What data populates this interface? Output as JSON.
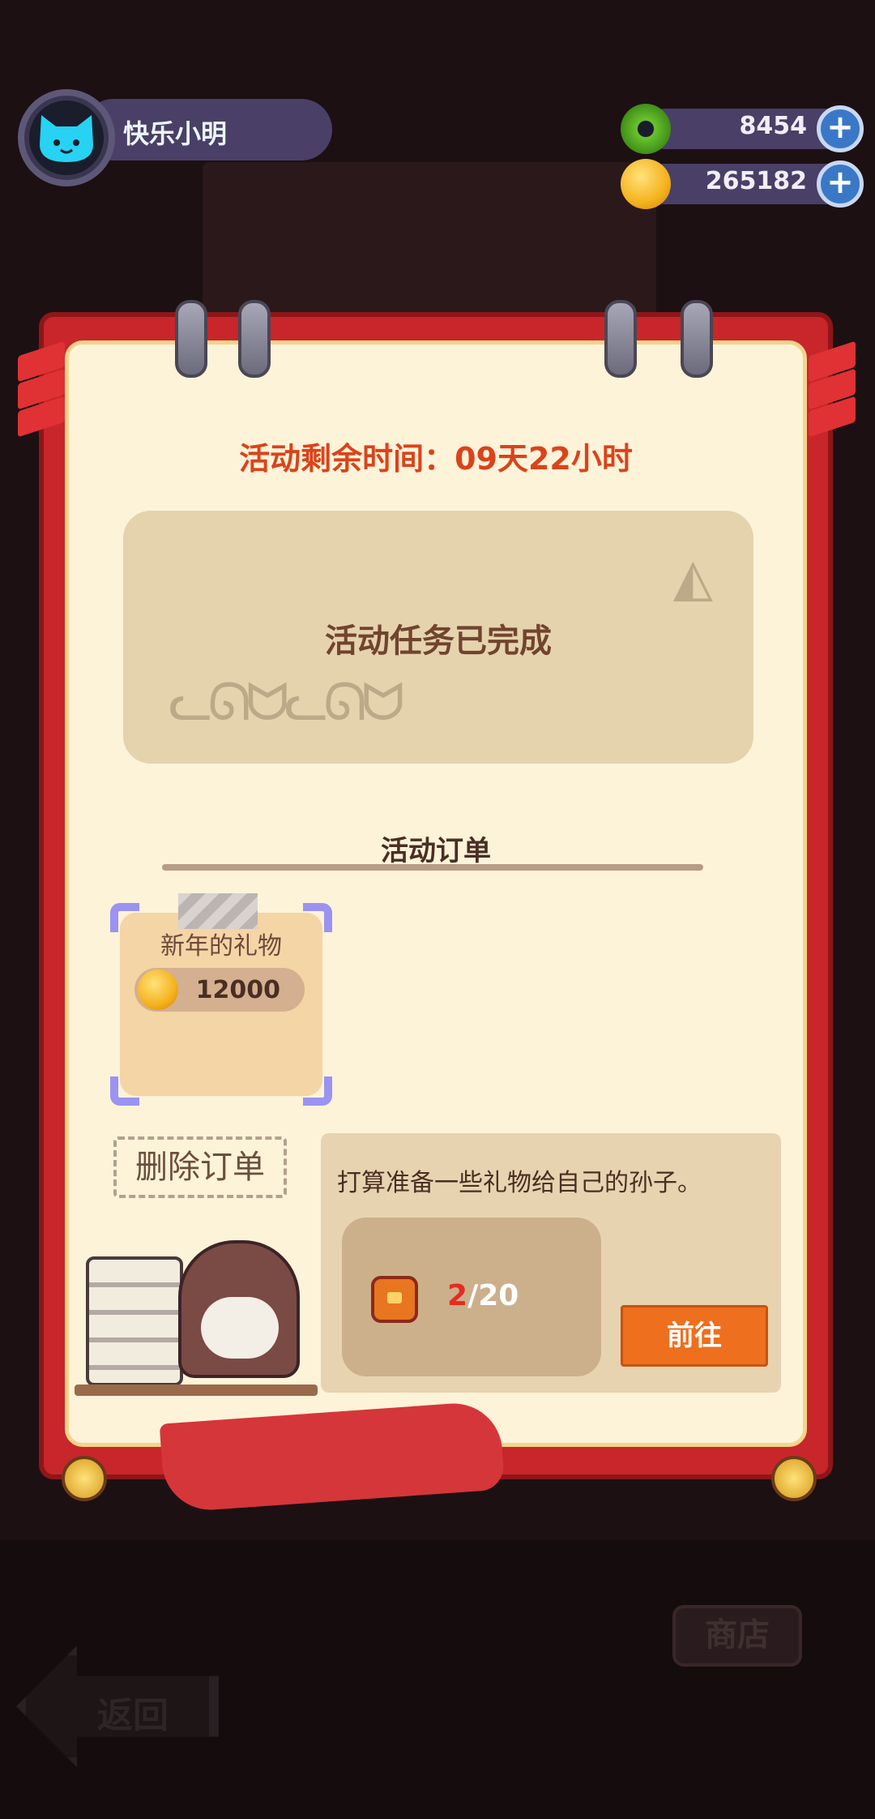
{
  "profile": {
    "name": "快乐小明"
  },
  "currencies": [
    {
      "icon": "green-donut-icon",
      "value": "8454",
      "color": "#5db524"
    },
    {
      "icon": "gold-coin-icon",
      "value": "265182",
      "color": "#f4b21d"
    }
  ],
  "event": {
    "timer_text": "活动剩余时间：09天22小时",
    "tasks_done_text": "活动任务已完成"
  },
  "orders": {
    "section_title": "活动订单",
    "items": [
      {
        "name": "新年的礼物",
        "reward": "12000"
      }
    ],
    "delete_label": "删除订单"
  },
  "order_detail": {
    "description": "打算准备一些礼物给自己的孙子。",
    "progress_current": "2",
    "progress_total": "/20",
    "goto_label": "前往"
  },
  "nav": {
    "back_label": "返回",
    "shop_label": "商店"
  },
  "colors": {
    "accent_orange": "#ee6f1e",
    "frame_red": "#c8262a",
    "paper": "#fdf3d9"
  }
}
